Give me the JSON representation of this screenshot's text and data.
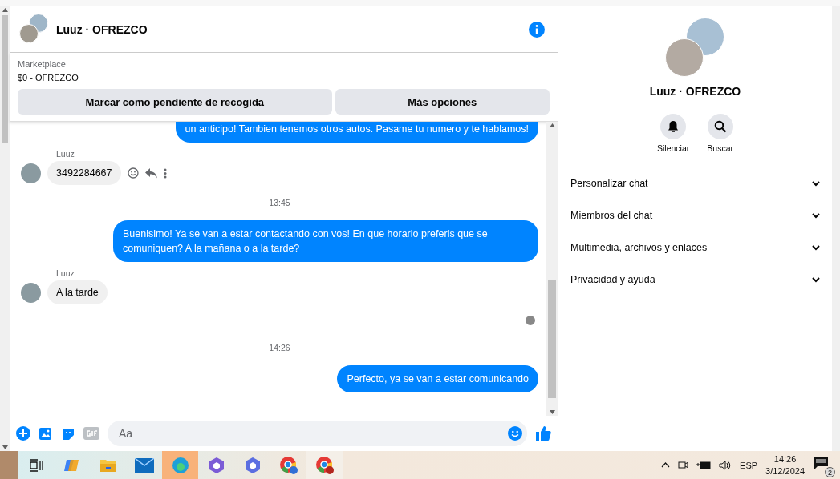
{
  "header": {
    "title": "Luuz · OFREZCO"
  },
  "listing": {
    "label": "Marketplace",
    "title": "$0 - OFREZCO"
  },
  "actions": [
    "Marcar como pendiente de recogida",
    "Más opciones"
  ],
  "messages": [
    {
      "kind": "outgoing",
      "text": "un anticipo! Tambien tenemos otros autos. Pasame tu numero y te hablamos!"
    },
    {
      "kind": "incoming",
      "sender": "Luuz",
      "text": "3492284667"
    },
    {
      "kind": "time",
      "text": "13:45"
    },
    {
      "kind": "outgoing",
      "text": "Buenisimo! Ya se van a estar contactando con vos! En que horario preferis que se comuniquen? A la mañana o a la tarde?"
    },
    {
      "kind": "incoming",
      "sender": "Luuz",
      "text": "A la tarde"
    },
    {
      "kind": "seen"
    },
    {
      "kind": "time",
      "text": "14:26"
    },
    {
      "kind": "outgoing",
      "text": "Perfecto, ya se van a estar comunicando"
    }
  ],
  "composer": {
    "placeholder": "Aa"
  },
  "profile": {
    "name": "Luuz · OFREZCO",
    "buttons": [
      {
        "kind": "mute",
        "label": "Silenciar"
      },
      {
        "kind": "search",
        "label": "Buscar"
      }
    ],
    "sections": [
      {
        "label": "Personalizar chat",
        "expanded": false
      },
      {
        "label": "Miembros del chat",
        "expanded": false
      },
      {
        "label": "Multimedia, archivos y enlaces",
        "expanded": false
      },
      {
        "label": "Privacidad y ayuda",
        "expanded": false
      }
    ]
  },
  "taskbar": {
    "language": "ESP",
    "time": "14:26",
    "date": "3/12/2024",
    "notifications": "2"
  }
}
